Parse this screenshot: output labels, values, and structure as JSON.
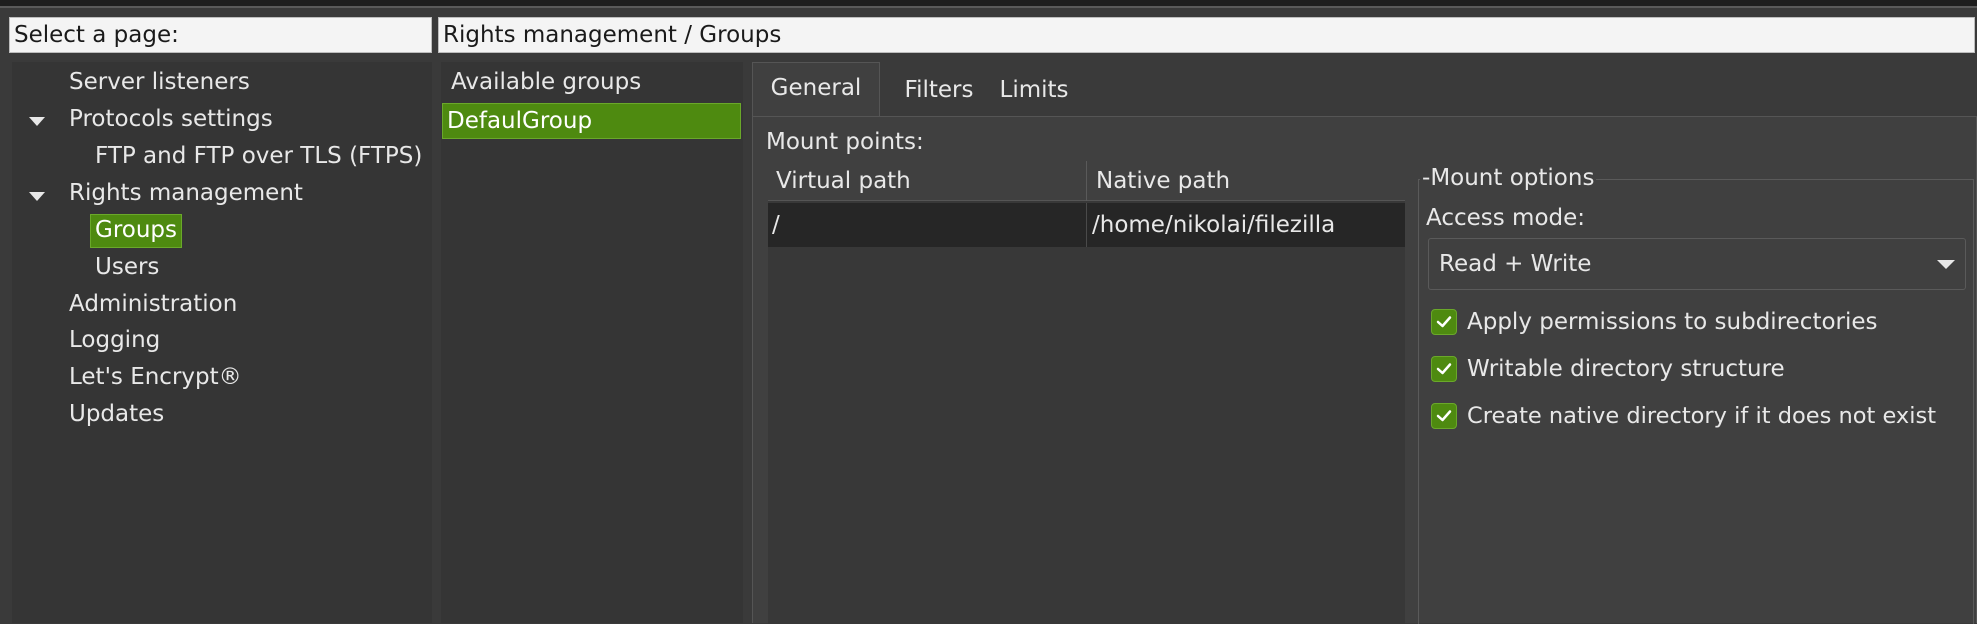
{
  "left_header": {
    "label": "Select a page:"
  },
  "main_header": {
    "breadcrumb": "Rights management / Groups"
  },
  "tree": {
    "items": [
      {
        "label": "Server listeners"
      },
      {
        "label": "Protocols settings"
      },
      {
        "label": "FTP and FTP over TLS (FTPS)"
      },
      {
        "label": "Rights management"
      },
      {
        "label": "Groups"
      },
      {
        "label": "Users"
      },
      {
        "label": "Administration"
      },
      {
        "label": "Logging"
      },
      {
        "label": "Let's Encrypt®"
      },
      {
        "label": "Updates"
      }
    ]
  },
  "groups": {
    "title": "Available groups",
    "items": [
      {
        "label": "DefaulGroup"
      }
    ]
  },
  "tabs": [
    {
      "label": "General"
    },
    {
      "label": "Filters"
    },
    {
      "label": "Limits"
    }
  ],
  "mount_points": {
    "label": "Mount points:",
    "columns": [
      "Virtual path",
      "Native path"
    ],
    "rows": [
      {
        "virtual": "/",
        "native": "/home/nikolai/filezilla"
      }
    ]
  },
  "mount_options": {
    "title": "Mount options",
    "access_mode_label": "Access mode:",
    "access_mode_value": "Read + Write",
    "checkboxes": [
      {
        "label": "Apply permissions to subdirectories",
        "checked": true
      },
      {
        "label": "Writable directory structure",
        "checked": true
      },
      {
        "label": "Create native directory if it does not exist",
        "checked": true
      }
    ]
  },
  "colors": {
    "selection": "#4e8a10",
    "panel": "#353535",
    "background": "#3a3a3a"
  }
}
